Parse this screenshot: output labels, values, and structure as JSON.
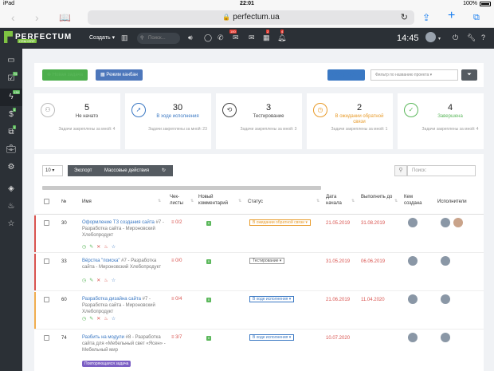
{
  "statusbar": {
    "device": "iPad",
    "time": "22:01",
    "battery": "100%"
  },
  "safari": {
    "url": "perfectum.ua",
    "lock_icon": "lock-icon",
    "reload_icon": "reload-icon"
  },
  "header": {
    "logo_text": "PERFECTUM",
    "logo_sub": "CRM+ERP",
    "create_label": "Создать",
    "search_placeholder": "Поиск...",
    "badges": {
      "mail": "100",
      "calendar": "2",
      "bell": "4"
    },
    "clock": "14:45"
  },
  "sidebar": {
    "items": [
      {
        "icon": "monitor-icon",
        "badge": ""
      },
      {
        "icon": "checklist-icon",
        "badge": "75"
      },
      {
        "icon": "bolt-icon",
        "badge": "138"
      },
      {
        "icon": "dollar-icon",
        "badge": "4"
      },
      {
        "icon": "copy-icon",
        "badge": "1"
      },
      {
        "icon": "briefcase-icon",
        "badge": ""
      },
      {
        "icon": "gear-icon",
        "badge": ""
      },
      {
        "icon": "layers-icon",
        "badge": ""
      },
      {
        "icon": "fire-icon",
        "badge": ""
      },
      {
        "icon": "star-icon",
        "badge": ""
      }
    ]
  },
  "toolbar": {
    "new_task": "Новая задача",
    "kanban": "Режим канбан",
    "overview": "Обзор задач",
    "filter_placeholder": "Фильтр по названию проекта"
  },
  "cards": [
    {
      "num": "5",
      "title": "Не начато",
      "sub": "Задачи закреплены за мной: 4",
      "color": "#444444",
      "icon": "user-icon"
    },
    {
      "num": "30",
      "title": "В ходе исполнения",
      "sub": "Задачи закреплены за мной: 23",
      "color": "#3a78c3",
      "icon": "rocket-icon"
    },
    {
      "num": "3",
      "title": "Тестирование",
      "sub": "Задачи закреплены за мной: 3",
      "color": "#444444",
      "icon": "sync-icon"
    },
    {
      "num": "2",
      "title": "В ожидании обратной связи",
      "sub": "Задачи закреплены за мной: 1",
      "color": "#e89b2a",
      "icon": "clock-icon"
    },
    {
      "num": "4",
      "title": "Завершена",
      "sub": "Задачи закреплены за мной: 4",
      "color": "#5cb85c",
      "icon": "check-circle-icon"
    }
  ],
  "table": {
    "page_length": "10",
    "export": "Экспорт",
    "bulk": "Массовые действия",
    "search_placeholder": "Поиск:",
    "headers": {
      "num": "№",
      "name": "Имя",
      "checklists": "Чек-листы",
      "new_comment": "Новый комментарий",
      "status": "Статус",
      "start": "Дата начала",
      "due": "Выполнить до",
      "created_by": "Кем создана",
      "assignees": "Исполнители"
    },
    "rows": [
      {
        "num": "30",
        "title": "Оформление ТЗ создания сайта",
        "ref": "#7",
        "project": "Разработка сайта - Мироновский Хлебопродукт",
        "check": "0/2",
        "comment": "0",
        "status": "В ожидании обратной связи",
        "status_color": "#e89b2a",
        "start": "21.05.2019",
        "due": "31.08.2019",
        "stripe": "#d9534f",
        "tag": ""
      },
      {
        "num": "33",
        "title": "Вёрстка \"поиска\"",
        "ref": "#7",
        "project": "Разработка сайта - Мироновский Хлебопродукт",
        "check": "0/0",
        "comment": "0",
        "status": "Тестирование",
        "status_color": "#555555",
        "start": "31.05.2019",
        "due": "06.06.2019",
        "stripe": "#d9534f",
        "tag": ""
      },
      {
        "num": "60",
        "title": "Разработка дизайна сайта",
        "ref": "#7",
        "project": "Разработка сайта - Мироновский Хлебопродукт",
        "check": "0/4",
        "comment": "0",
        "status": "В ходе исполнения",
        "status_color": "#3a78c3",
        "start": "21.06.2019",
        "due": "11.04.2020",
        "stripe": "#f0ad4e",
        "tag": ""
      },
      {
        "num": "74",
        "title": "Разбить на модули",
        "ref": "#8",
        "project": "Разработка сайта для «Мебельный свет «Ясен» - Мебельный мир",
        "check": "3/7",
        "comment": "0",
        "status": "В ходе исполнения",
        "status_color": "#3a78c3",
        "start": "10.07.2020",
        "due": "",
        "stripe": "",
        "tag": "Повторяющаяся задача"
      }
    ]
  }
}
